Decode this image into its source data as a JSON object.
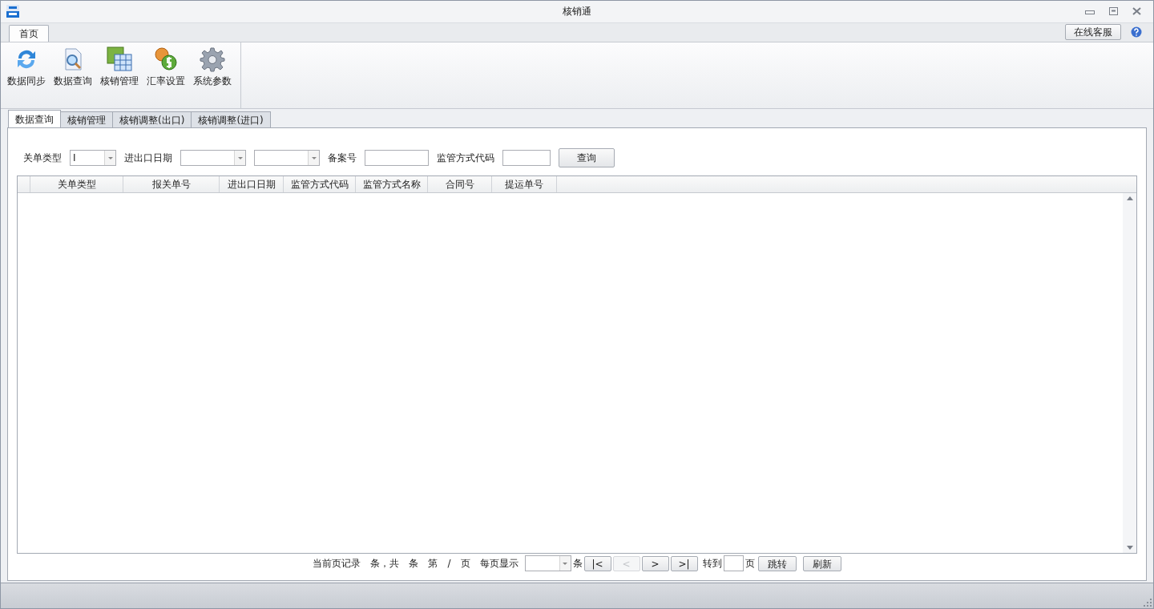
{
  "window": {
    "title": "核销通"
  },
  "ribbon": {
    "tabs": [
      {
        "label": "首页",
        "selected": true
      }
    ],
    "service_button": "在线客服",
    "buttons": [
      {
        "label": "数据同步",
        "kind": "sync"
      },
      {
        "label": "数据查询",
        "kind": "query"
      },
      {
        "label": "核销管理",
        "kind": "manage"
      },
      {
        "label": "汇率设置",
        "kind": "rate"
      },
      {
        "label": "系统参数",
        "kind": "settings"
      }
    ]
  },
  "doc_tabs": [
    {
      "label": "数据查询",
      "selected": true
    },
    {
      "label": "核销管理",
      "selected": false
    },
    {
      "label": "核销调整(出口)",
      "selected": false
    },
    {
      "label": "核销调整(进口)",
      "selected": false
    }
  ],
  "filters": [
    {
      "label": "关单类型",
      "kind": "combo",
      "value": "I"
    },
    {
      "label": "进出口日期",
      "kind": "combo"
    },
    {
      "kind": "combo"
    },
    {
      "label": "备案号",
      "kind": "text"
    },
    {
      "label": "监管方式代码",
      "kind": "text"
    }
  ],
  "query_button": "查询",
  "table": {
    "columns": [
      "关单类型",
      "报关单号",
      "进出口日期",
      "监管方式代码",
      "监管方式名称",
      "合同号",
      "提运单号"
    ]
  },
  "pager": {
    "texts_before": [
      "当前页记录",
      "条，共",
      "条",
      "第",
      "/",
      "页",
      "每页显示"
    ],
    "per_page_unit": "条",
    "nav": [
      {
        "label": "|<",
        "disabled": false
      },
      {
        "label": "<",
        "disabled": true
      },
      {
        "label": ">",
        "disabled": false
      },
      {
        "label": ">|",
        "disabled": false
      }
    ],
    "goto_label": "转到",
    "goto_unit": "页",
    "jump_button": "跳转",
    "refresh_button": "刷新"
  }
}
